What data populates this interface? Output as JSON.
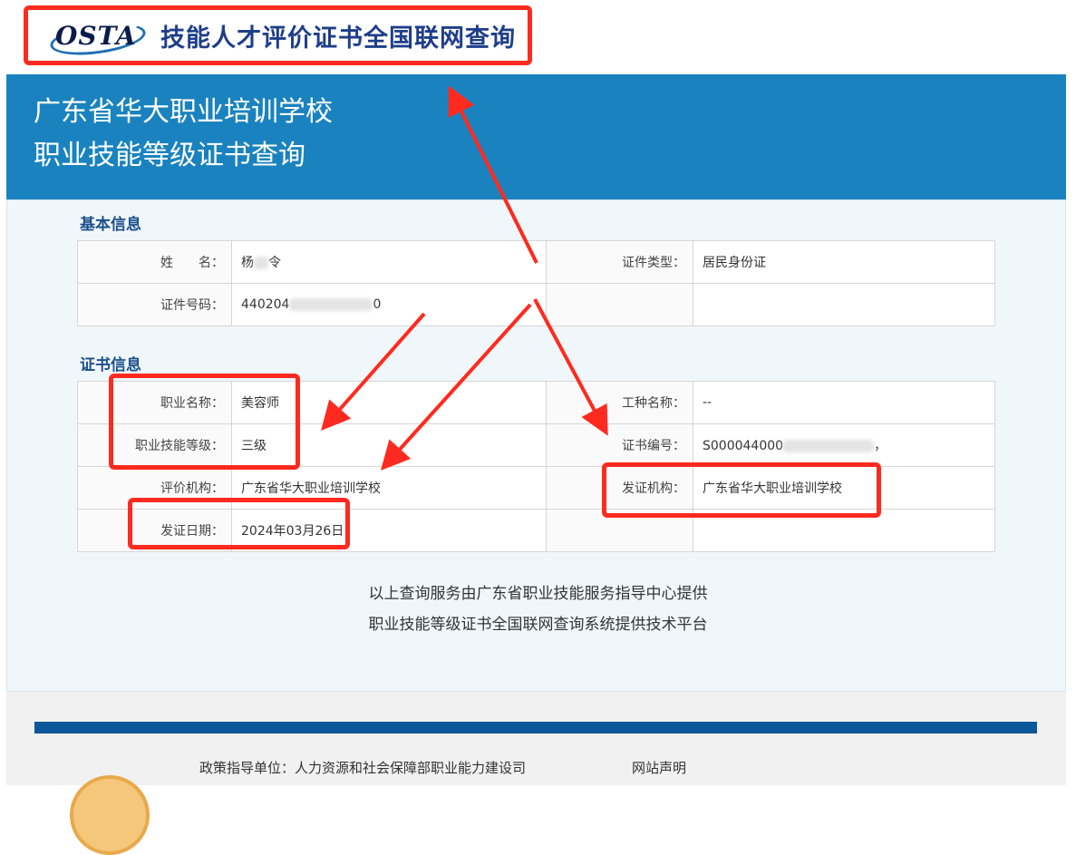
{
  "header": {
    "logo_text": "OSTA",
    "site_title": "技能人才评价证书全国联网查询"
  },
  "banner": {
    "line1": "广东省华大职业培训学校",
    "line2": "职业技能等级证书查询"
  },
  "basic_info": {
    "title": "基本信息",
    "name_label": "姓　　名：",
    "name_value_visible": "杨",
    "name_value_tail": "令",
    "id_type_label": "证件类型：",
    "id_type_value": "居民身份证",
    "id_no_label": "证件号码：",
    "id_no_prefix": "440204",
    "id_no_suffix": "0"
  },
  "cert_info": {
    "title": "证书信息",
    "occupation_label": "职业名称：",
    "occupation_value": "美容师",
    "work_type_label": "工种名称：",
    "work_type_value": "--",
    "level_label": "职业技能等级：",
    "level_value": "三级",
    "cert_no_label": "证书编号：",
    "cert_no_prefix": "S000044000",
    "cert_no_suffix": "，",
    "eval_org_label": "评价机构：",
    "eval_org_value": "广东省华大职业培训学校",
    "issuer_label": "发证机构：",
    "issuer_value": "广东省华大职业培训学校",
    "issue_date_label": "发证日期：",
    "issue_date_value": "2024年03月26日"
  },
  "notes": {
    "line1": "以上查询服务由广东省职业技能服务指导中心提供",
    "line2": "职业技能等级证书全国联网查询系统提供技术平台"
  },
  "footer": {
    "policy_unit": "政策指导单位：人力资源和社会保障部职业能力建设司",
    "site_statement": "网站声明"
  },
  "colors": {
    "banner": "#1a83bf",
    "annotation": "#ff2a1f",
    "footer_bar": "#0a5799"
  }
}
